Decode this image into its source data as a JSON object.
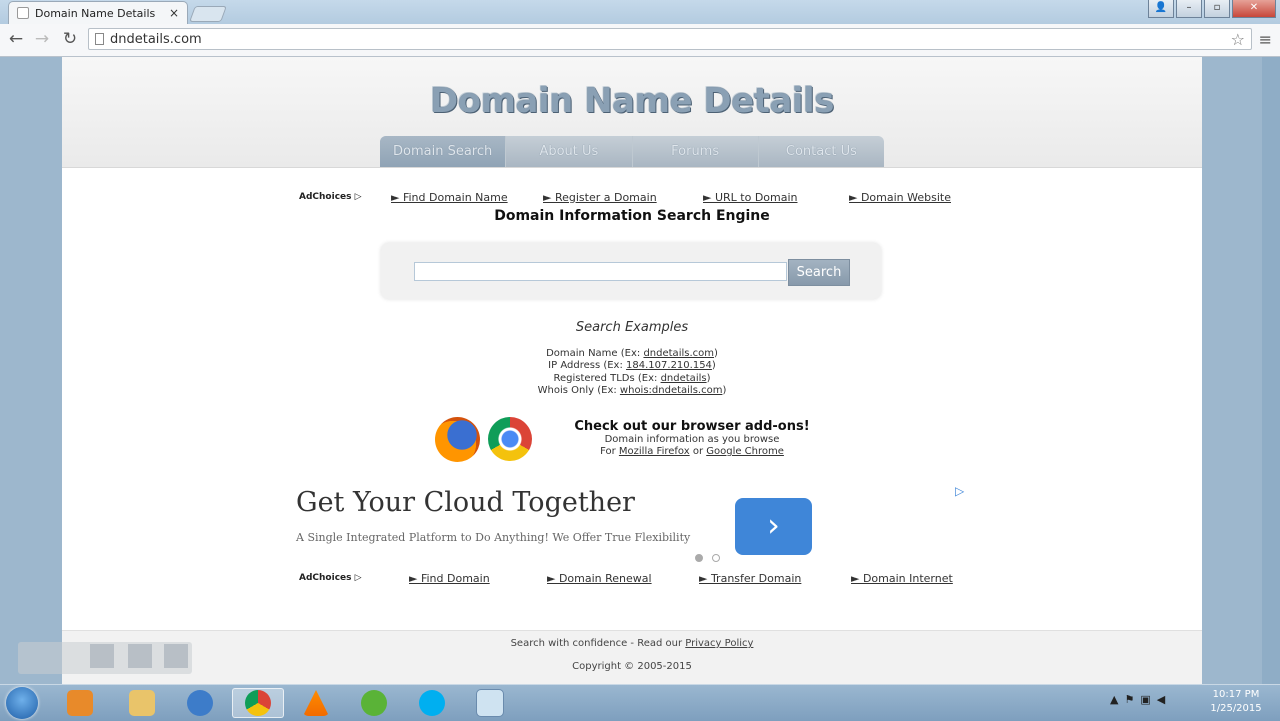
{
  "browser": {
    "tab_title": "Domain Name Details",
    "url": "dndetails.com"
  },
  "site": {
    "title": "Domain Name Details",
    "nav": [
      {
        "label": "Domain Search"
      },
      {
        "label": "About Us"
      },
      {
        "label": "Forums"
      },
      {
        "label": "Contact Us"
      }
    ],
    "adchoices": "AdChoices",
    "top_links": [
      "► Find Domain Name",
      "► Register a Domain",
      "► URL to Domain",
      "► Domain Website"
    ],
    "engine_title": "Domain Information Search Engine",
    "search": {
      "button_label": "Search",
      "value": ""
    },
    "examples_title": "Search Examples",
    "examples": [
      {
        "prefix": "Domain Name (Ex: ",
        "link": "dndetails.com",
        "suffix": ")"
      },
      {
        "prefix": "IP Address (Ex: ",
        "link": "184.107.210.154",
        "suffix": ")"
      },
      {
        "prefix": "Registered TLDs (Ex: ",
        "link": "dndetails",
        "suffix": ")"
      },
      {
        "prefix": "Whois Only (Ex: ",
        "link": "whois:dndetails.com",
        "suffix": ")"
      }
    ],
    "addons": {
      "heading": "Check out our browser add-ons!",
      "line1": "Domain information as you browse",
      "line2_prefix": "For ",
      "firefox": "Mozilla Firefox",
      "or": " or ",
      "chrome": "Google Chrome"
    },
    "ad": {
      "headline": "Get Your Cloud Together",
      "sub": "A Single Integrated Platform to Do Anything! We Offer True Flexibility"
    },
    "bottom_links": [
      "► Find Domain",
      "► Domain Renewal",
      "► Transfer Domain",
      "► Domain Internet"
    ],
    "footer": {
      "line1_prefix": "Search with confidence - Read our ",
      "privacy": "Privacy Policy",
      "copyright": "Copyright © 2005-2015"
    }
  },
  "taskbar": {
    "time": "10:17 PM",
    "date": "1/25/2015"
  }
}
